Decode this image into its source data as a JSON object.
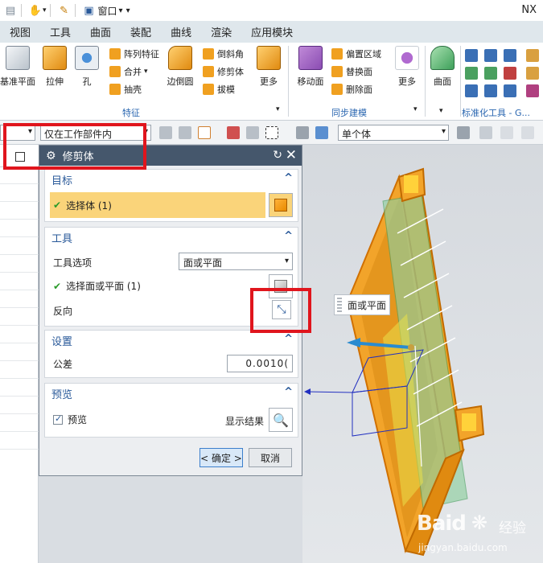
{
  "titlebar": {
    "window_menu": "窗口",
    "window_menu_arrow": "▾",
    "extra_arrow": "▾",
    "app_title": "NX"
  },
  "menubar": {
    "items": [
      "视图",
      "工具",
      "曲面",
      "装配",
      "曲线",
      "渲染",
      "应用模块"
    ]
  },
  "ribbon": {
    "datum_plane": "基准平面",
    "extrude": "拉伸",
    "hole": "孔",
    "pattern_feature": "阵列特征",
    "unite": "合并",
    "shell": "抽壳",
    "edge_blend": "边倒圆",
    "chamfer": "倒斜角",
    "trim_body": "修剪体",
    "draft": "拔模",
    "more_1": "更多",
    "group_feature": "特征",
    "move_face": "移动面",
    "offset_region": "偏置区域",
    "replace_face": "替换面",
    "delete_face": "删除面",
    "more_2": "更多",
    "group_sync": "同步建模",
    "surface": "曲面",
    "group_std": "标准化工具 - G..."
  },
  "toolbar": {
    "filter_scope": "仅在工作部件内",
    "body_rule": "单个体"
  },
  "dialog": {
    "title": "修剪体",
    "target": {
      "header": "目标",
      "select_body": "选择体 (1)"
    },
    "tool": {
      "header": "工具",
      "tool_option_label": "工具选项",
      "tool_option_value": "面或平面",
      "select_face": "选择面或平面 (1)",
      "reverse": "反向"
    },
    "settings": {
      "header": "设置",
      "tolerance_label": "公差",
      "tolerance_value": "0.0010("
    },
    "preview": {
      "header": "预览",
      "preview_check": "预览",
      "show_result": "显示结果"
    },
    "ok": "< 确定 >",
    "cancel": "取消"
  },
  "tooltip": {
    "text": "面或平面"
  },
  "watermark": {
    "brand": "Baid",
    "brand_cn": "经验",
    "url": "jingyan.baidu.com"
  },
  "colors": {
    "dialog_title_bg": "#45576c",
    "target_row_bg": "#fad47a",
    "highlight_red": "#e0151d",
    "section_header": "#2a5a9a",
    "part_orange": "#f0a020"
  }
}
